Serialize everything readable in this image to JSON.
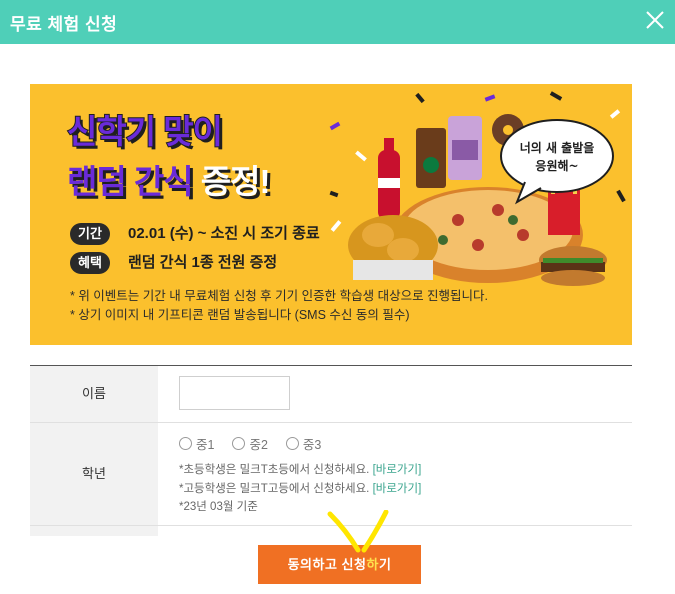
{
  "header": {
    "title": "무료 체험 신청",
    "close_icon": "close-icon",
    "bg_color": "#4fcfb8"
  },
  "banner": {
    "title_line1": "신학기 맞이",
    "title_line2_part1": "랜덤 간식",
    "title_line2_part2": "증정!",
    "period_tag": "기간",
    "period_text": "02.01 (수) ~ 소진 시 조기 종료",
    "benefit_tag": "혜택",
    "benefit_text": "랜덤 간식 1종 전원 증정",
    "note1": "* 위 이벤트는 기간 내 무료체험 신청 후 기기 인증한 학습생 대상으로 진행됩니다.",
    "note2": "* 상기 이미지 내 기프티콘 랜덤 발송됩니다 (SMS 수신 동의 필수)",
    "speech_line1": "너의 새 출발을",
    "speech_line2": "응원해~",
    "accent_color": "#fbc02d",
    "purple_color": "#6a2bd9"
  },
  "form": {
    "name_label": "이름",
    "name_value": "",
    "grade_label": "학년",
    "grade_options": [
      "중1",
      "중2",
      "중3"
    ],
    "grade_note1_text": "*초등학생은 밀크T초등에서 신청하세요.",
    "grade_note2_text": "*고등학생은 밀크T고등에서 신청하세요.",
    "go_link": "[바로가기]",
    "grade_note3": "*23년 03월 기준"
  },
  "submit": {
    "label_before": "동의하고 신청",
    "label_highlight": "하",
    "label_after": "기",
    "color": "#f07023"
  }
}
